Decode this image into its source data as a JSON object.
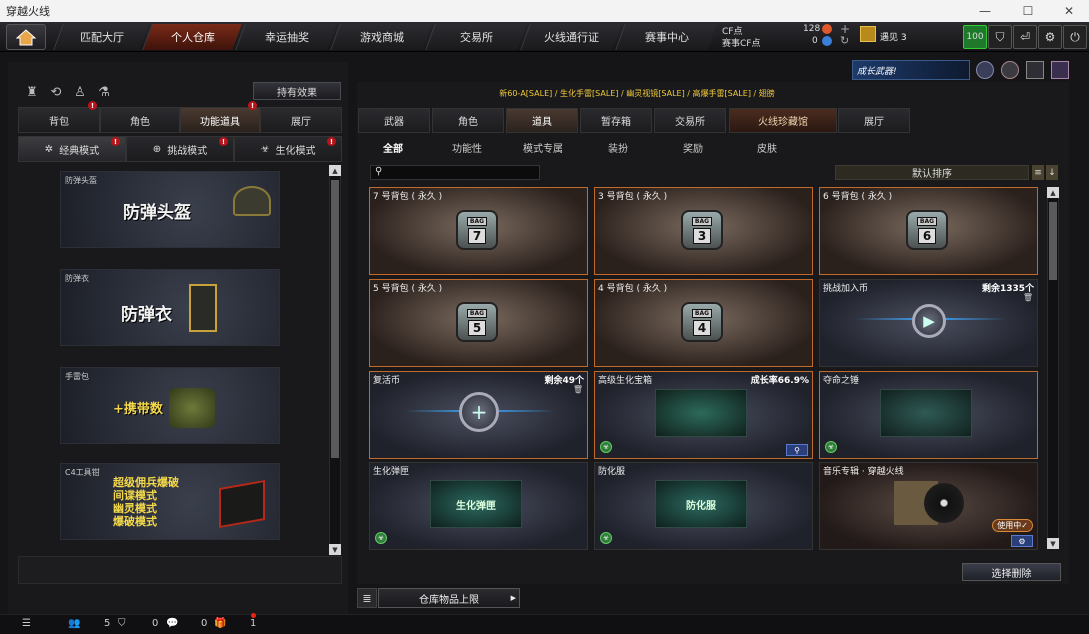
{
  "window": {
    "title": "穿越火线"
  },
  "topnav": {
    "tabs": [
      "匹配大厅",
      "个人仓库",
      "幸运抽奖",
      "游戏商城",
      "交易所",
      "火线通行证",
      "赛事中心"
    ],
    "active_index": 1,
    "cf_label": "CF点",
    "cf_value": "128",
    "event_cf_label": "赛事CF点",
    "event_cf_value": "0",
    "user_name": "遇见 3",
    "level_badge": "100"
  },
  "left": {
    "effect_button": "持有效果",
    "tabs": [
      "背包",
      "角色",
      "功能道具",
      "展厅"
    ],
    "active_tab": 2,
    "modes": [
      "经典模式",
      "挑战模式",
      "生化模式"
    ],
    "cards": [
      {
        "label": "防弹头盔",
        "big": "防弹头盔"
      },
      {
        "label": "防弹衣",
        "big": "防弹衣"
      },
      {
        "label": "手雷包",
        "big": "+携带数"
      },
      {
        "label": "C4工具钳",
        "lines": [
          "超级佣兵爆破",
          "间谍模式",
          "幽灵模式",
          "爆破模式"
        ]
      }
    ]
  },
  "right": {
    "promo_banner": "成长武器!",
    "promo_text": "新60-A[SALE] / 生化手雷[SALE] / 幽灵视镜[SALE] / 高爆手雷[SALE] / 翅膀",
    "tabs": [
      "武器",
      "角色",
      "道具",
      "暂存箱",
      "交易所",
      "火线珍藏馆",
      "展厅"
    ],
    "active_tab": 2,
    "subtabs": [
      "全部",
      "功能性",
      "模式专属",
      "装扮",
      "奖励",
      "皮肤"
    ],
    "sort_label": "默认排序",
    "items": [
      {
        "name": "7 号背包 ( 永久 )",
        "type": "bag",
        "num": "7"
      },
      {
        "name": "3 号背包 ( 永久 )",
        "type": "bag",
        "num": "3"
      },
      {
        "name": "6 号背包 ( 永久 )",
        "type": "bag",
        "num": "6"
      },
      {
        "name": "5 号背包 ( 永久 )",
        "type": "bag",
        "num": "5"
      },
      {
        "name": "4 号背包 ( 永久 )",
        "type": "bag",
        "num": "4"
      },
      {
        "name": "挑战加入币",
        "type": "coin",
        "count": "剩余1335个"
      },
      {
        "name": "复活币",
        "type": "coin",
        "count": "剩余49个"
      },
      {
        "name": "高级生化宝箱",
        "type": "box",
        "count": "成长率66.9%"
      },
      {
        "name": "夺命之锤",
        "type": "hammer"
      },
      {
        "name": "生化弹匣",
        "type": "mag",
        "pic_text": "生化弹匣"
      },
      {
        "name": "防化服",
        "type": "suit",
        "pic_text": "防化服"
      },
      {
        "name": "音乐专辑 · 穿越火线",
        "type": "music",
        "in_use": "使用中✓"
      }
    ],
    "select_delete": "选择删除",
    "storage_limit": "仓库物品上限"
  },
  "statusbar": {
    "friends": "5",
    "chat": "0",
    "gift": "0",
    "mail": "1"
  }
}
